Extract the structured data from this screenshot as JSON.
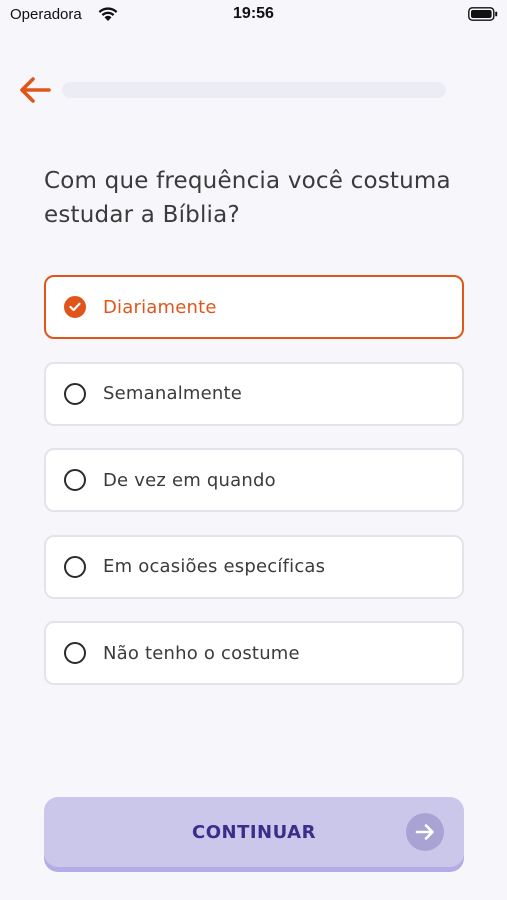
{
  "status_bar": {
    "carrier": "Operadora",
    "time": "19:56"
  },
  "nav": {
    "back_icon": "arrow-left-icon",
    "progress_fraction": 0.0
  },
  "question": "Com que frequência você costuma estudar a Bíblia?",
  "options": [
    {
      "label": "Diariamente",
      "selected": true
    },
    {
      "label": "Semanalmente",
      "selected": false
    },
    {
      "label": "De vez em quando",
      "selected": false
    },
    {
      "label": "Em ocasiões específicas",
      "selected": false
    },
    {
      "label": "Não tenho o costume",
      "selected": false
    }
  ],
  "continue_button": {
    "label": "CONTINUAR",
    "icon": "arrow-right-icon"
  },
  "colors": {
    "accent": "#e0561a",
    "button_bg": "#cbc7ea",
    "button_text": "#3a2e8a",
    "background": "#f6f6fb"
  }
}
